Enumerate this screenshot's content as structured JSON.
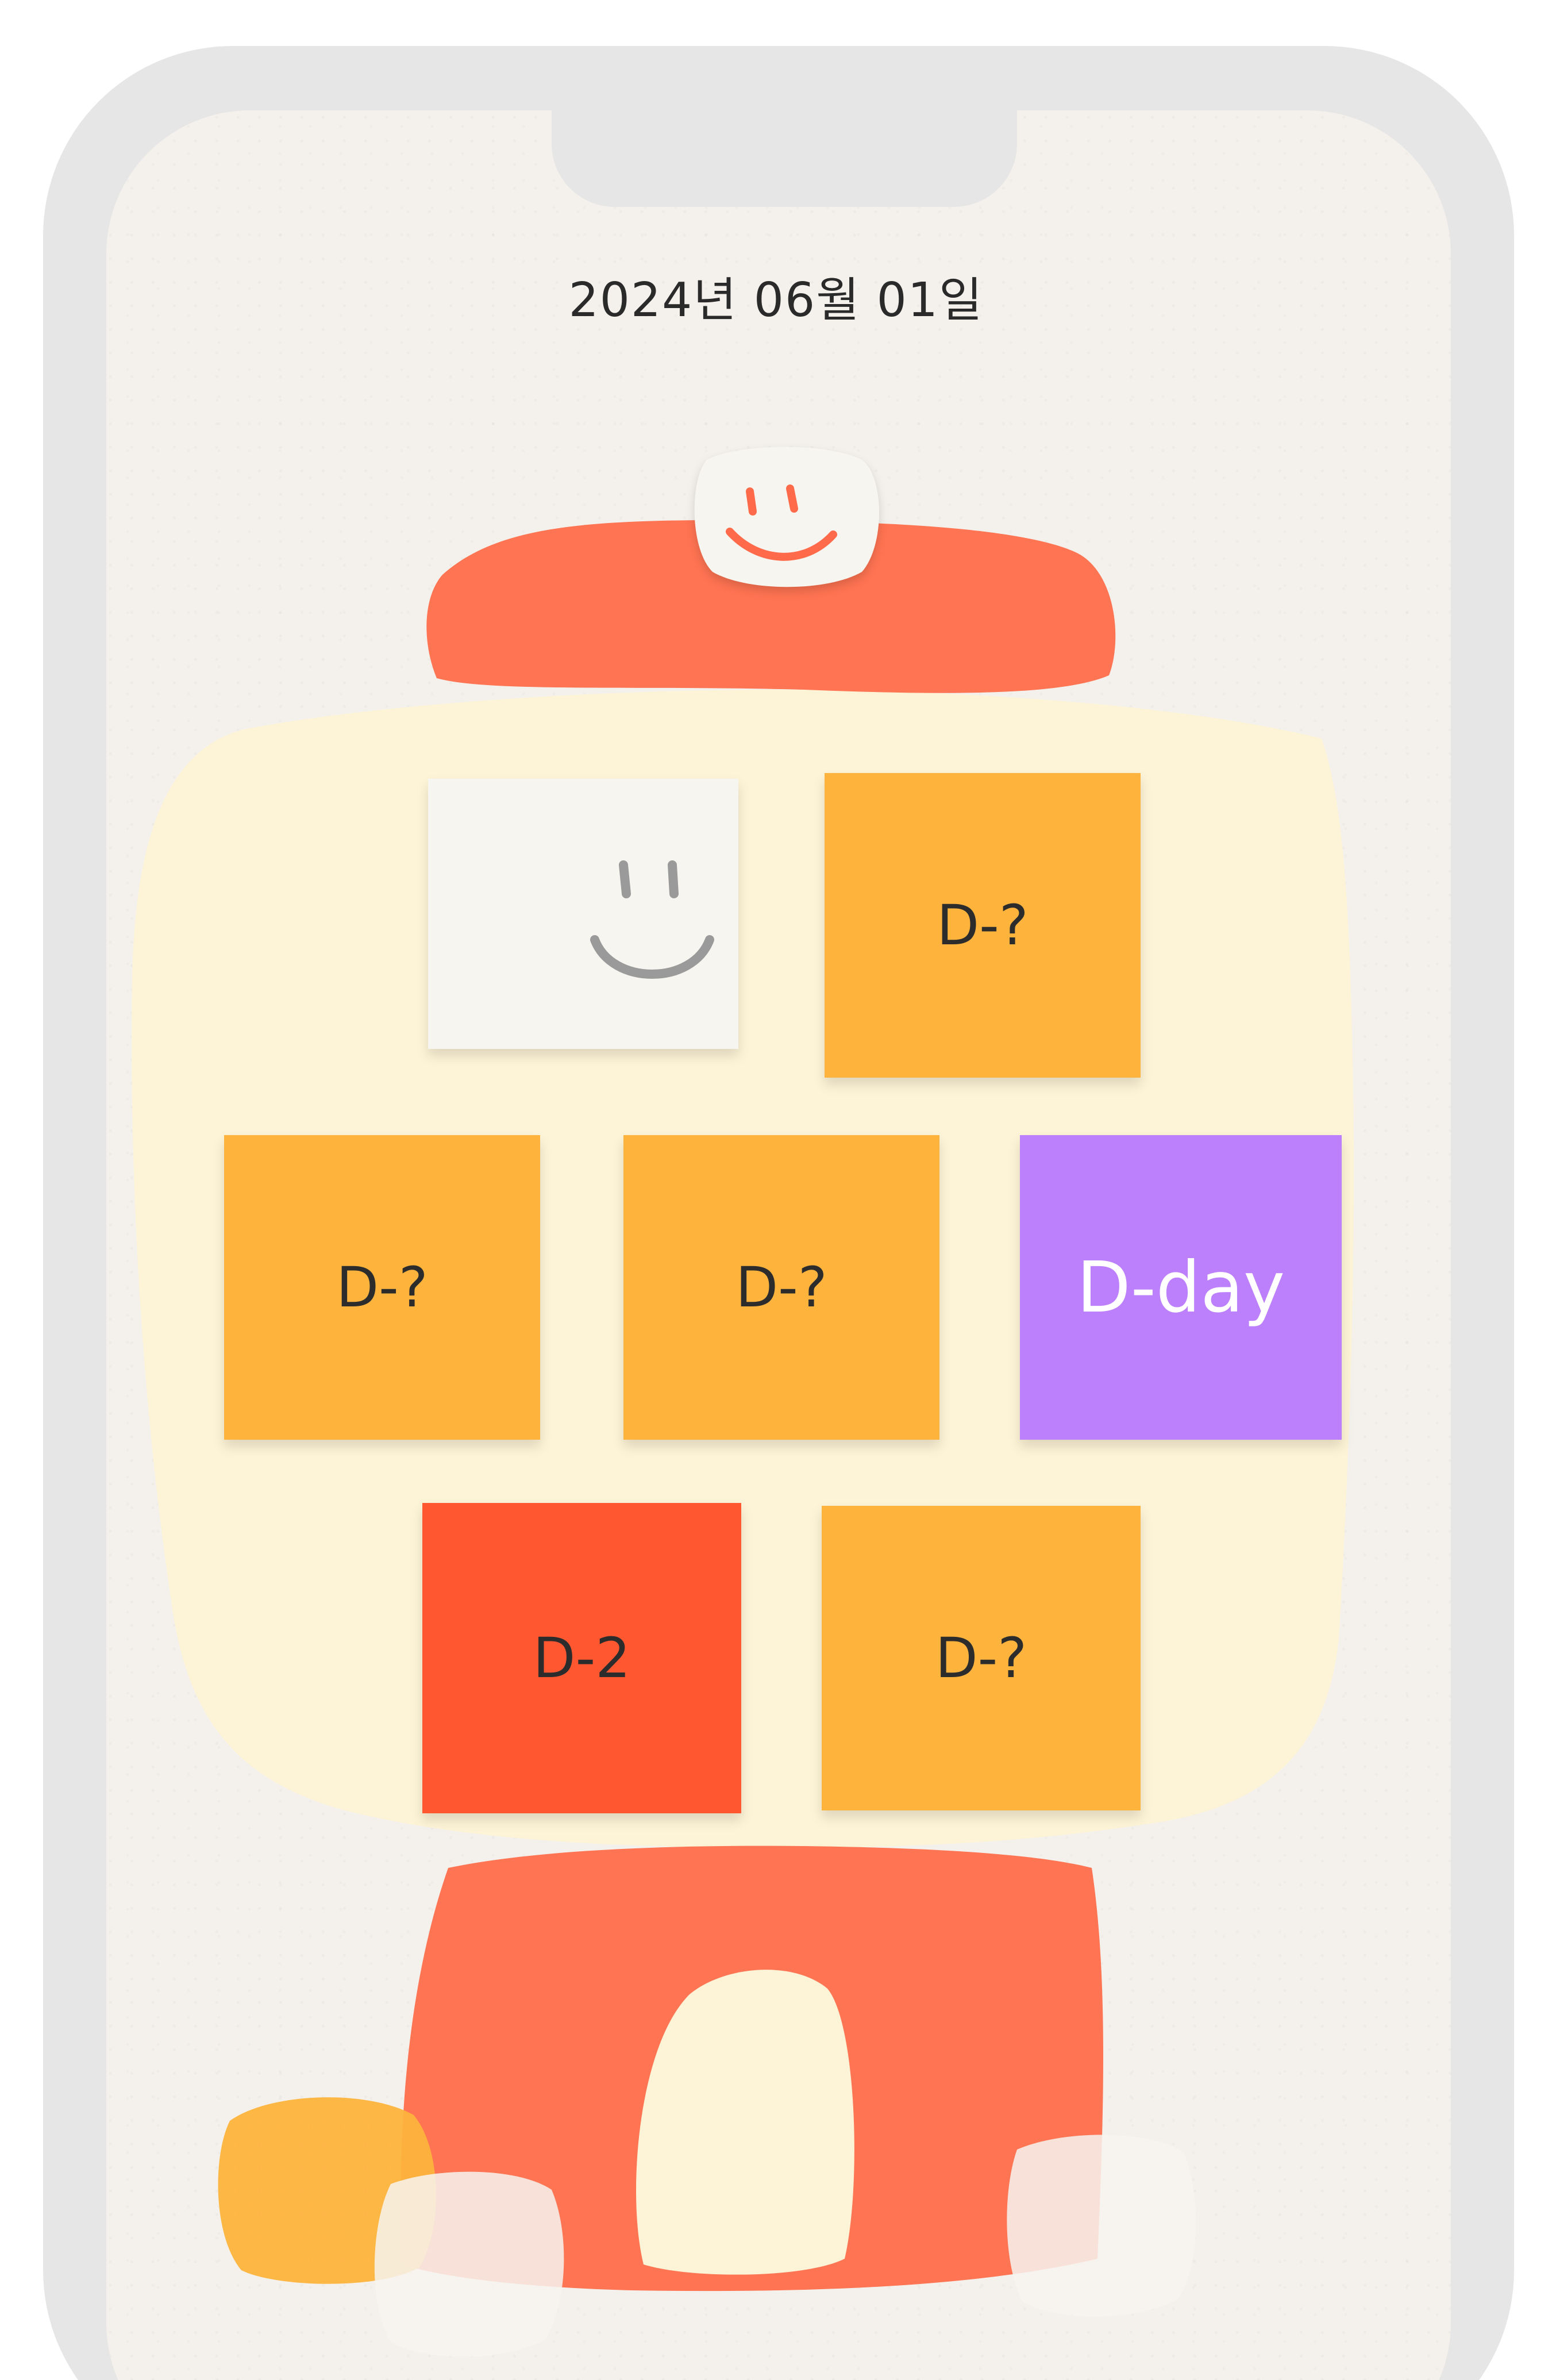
{
  "status": {
    "date": "2024년 06월 01일"
  },
  "capsules": [
    {
      "label": "D-?"
    },
    {
      "label": "D-?"
    },
    {
      "label": "D-?"
    },
    {
      "label": "D-day"
    },
    {
      "label": "D-2"
    },
    {
      "label": "D-?"
    }
  ],
  "colors": {
    "screen_background": "#f4f1ec",
    "globe": "#fdf3d6",
    "machine_red": "#ff7452",
    "capsule_orange": "#fdb33c",
    "capsule_red": "#ff5730",
    "capsule_purple": "#bd80fc",
    "capsule_white": "#f7f5f0"
  },
  "icons": [
    "smile-icon",
    "gumball-machine-illustration"
  ]
}
